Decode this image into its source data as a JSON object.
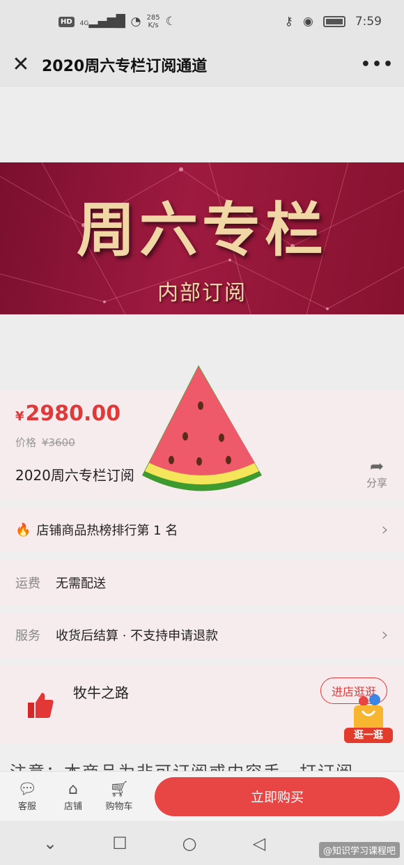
{
  "status_bar": {
    "hd": "HD",
    "network": "4G",
    "speed_value": "285",
    "speed_unit": "K/s",
    "time": "7:59"
  },
  "title_bar": {
    "title": "2020周六专栏订阅通道"
  },
  "banner": {
    "title": "周六专栏",
    "subtitle": "内部订阅"
  },
  "product": {
    "price_symbol": "¥",
    "price": "2980.00",
    "original_label": "价格",
    "original_price": "¥3600",
    "name": "2020周六专栏订阅",
    "share_label": "分享"
  },
  "rank_row": {
    "text": "店铺商品热榜排行第 1 名"
  },
  "fee_row": {
    "label": "运费",
    "value": "无需配送"
  },
  "service_row": {
    "label": "服务",
    "value": "收货后结算 · 不支持申请退款"
  },
  "shop": {
    "name": "牧牛之路",
    "visit_label": "进店逛逛",
    "stroll_label": "逛一逛"
  },
  "notice": {
    "text": "注意：本商品为非可订阅或内容手，打订阅"
  },
  "bottom_bar": {
    "service": "客服",
    "store": "店铺",
    "cart": "购物车",
    "buy": "立即购买"
  },
  "watermark": "@知识学习课程吧",
  "colors": {
    "accent": "#e84545",
    "price": "#e0393a",
    "banner": "#8e1535",
    "banner_text": "#f1d7a6"
  }
}
